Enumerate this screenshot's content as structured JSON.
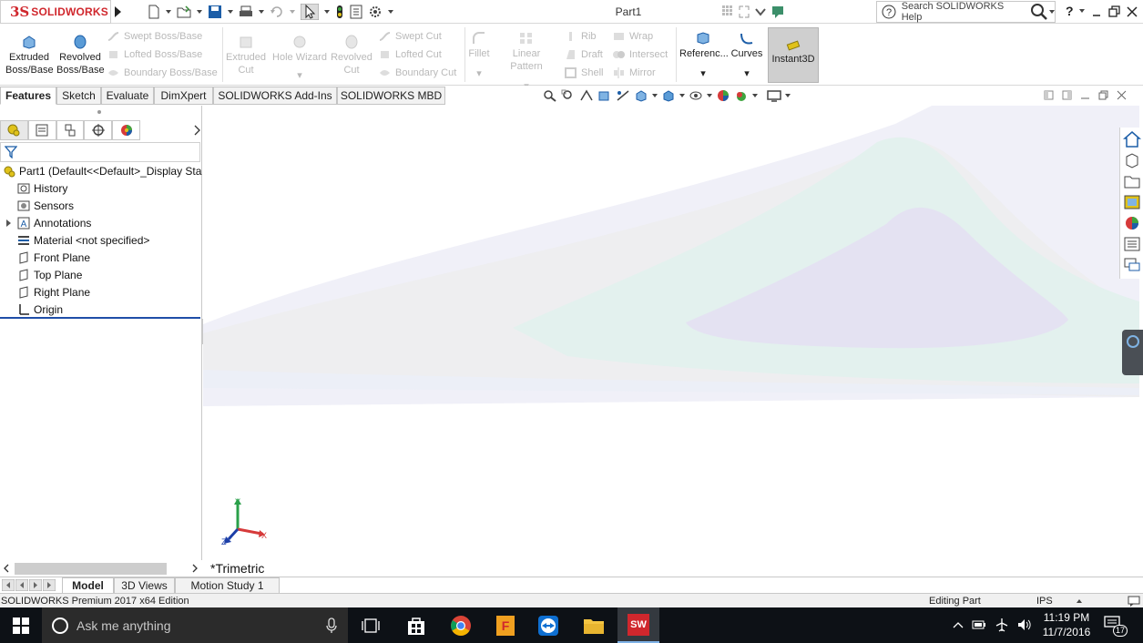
{
  "app": {
    "logo_prefix": "3S",
    "logo_text": "SOLIDWORKS",
    "document_title": "Part1",
    "search_placeholder": "Search SOLIDWORKS Help",
    "help_label": "?"
  },
  "toolbar": {
    "extruded_boss": "Extruded Boss/Base",
    "revolved_boss": "Revolved Boss/Base",
    "swept_boss": "Swept Boss/Base",
    "lofted_boss": "Lofted Boss/Base",
    "boundary_boss": "Boundary Boss/Base",
    "extruded_cut": "Extruded Cut",
    "hole_wizard": "Hole Wizard",
    "revolved_cut": "Revolved Cut",
    "swept_cut": "Swept Cut",
    "lofted_cut": "Lofted Cut",
    "boundary_cut": "Boundary Cut",
    "fillet": "Fillet",
    "linear_pattern": "Linear Pattern",
    "rib": "Rib",
    "draft": "Draft",
    "shell": "Shell",
    "wrap": "Wrap",
    "intersect": "Intersect",
    "mirror": "Mirror",
    "reference": "Referenc...",
    "curves": "Curves",
    "instant3d": "Instant3D"
  },
  "tabs": [
    "Features",
    "Sketch",
    "Evaluate",
    "DimXpert",
    "SOLIDWORKS Add-Ins",
    "SOLIDWORKS MBD"
  ],
  "tree": {
    "root": "Part1  (Default<<Default>_Display Sta",
    "items": [
      "History",
      "Sensors",
      "Annotations",
      "Material <not specified>",
      "Front Plane",
      "Top Plane",
      "Right Plane",
      "Origin"
    ]
  },
  "graphics": {
    "view_label": "*Trimetric",
    "triad": {
      "y": "Y",
      "x": "X",
      "z": "Z"
    }
  },
  "bottom_tabs": [
    "Model",
    "3D Views",
    "Motion Study 1"
  ],
  "status": {
    "edition": "SOLIDWORKS Premium 2017 x64 Edition",
    "mode": "Editing Part",
    "units": "IPS"
  },
  "taskbar": {
    "search_placeholder": "Ask me anything",
    "time": "11:19 PM",
    "date": "11/7/2016",
    "notifications": "17",
    "sw_badge": "SW"
  },
  "colors": {
    "brand_red": "#d0272d",
    "taskbar_bg": "#0d1116",
    "rollback_bar": "#1f4ea8"
  }
}
